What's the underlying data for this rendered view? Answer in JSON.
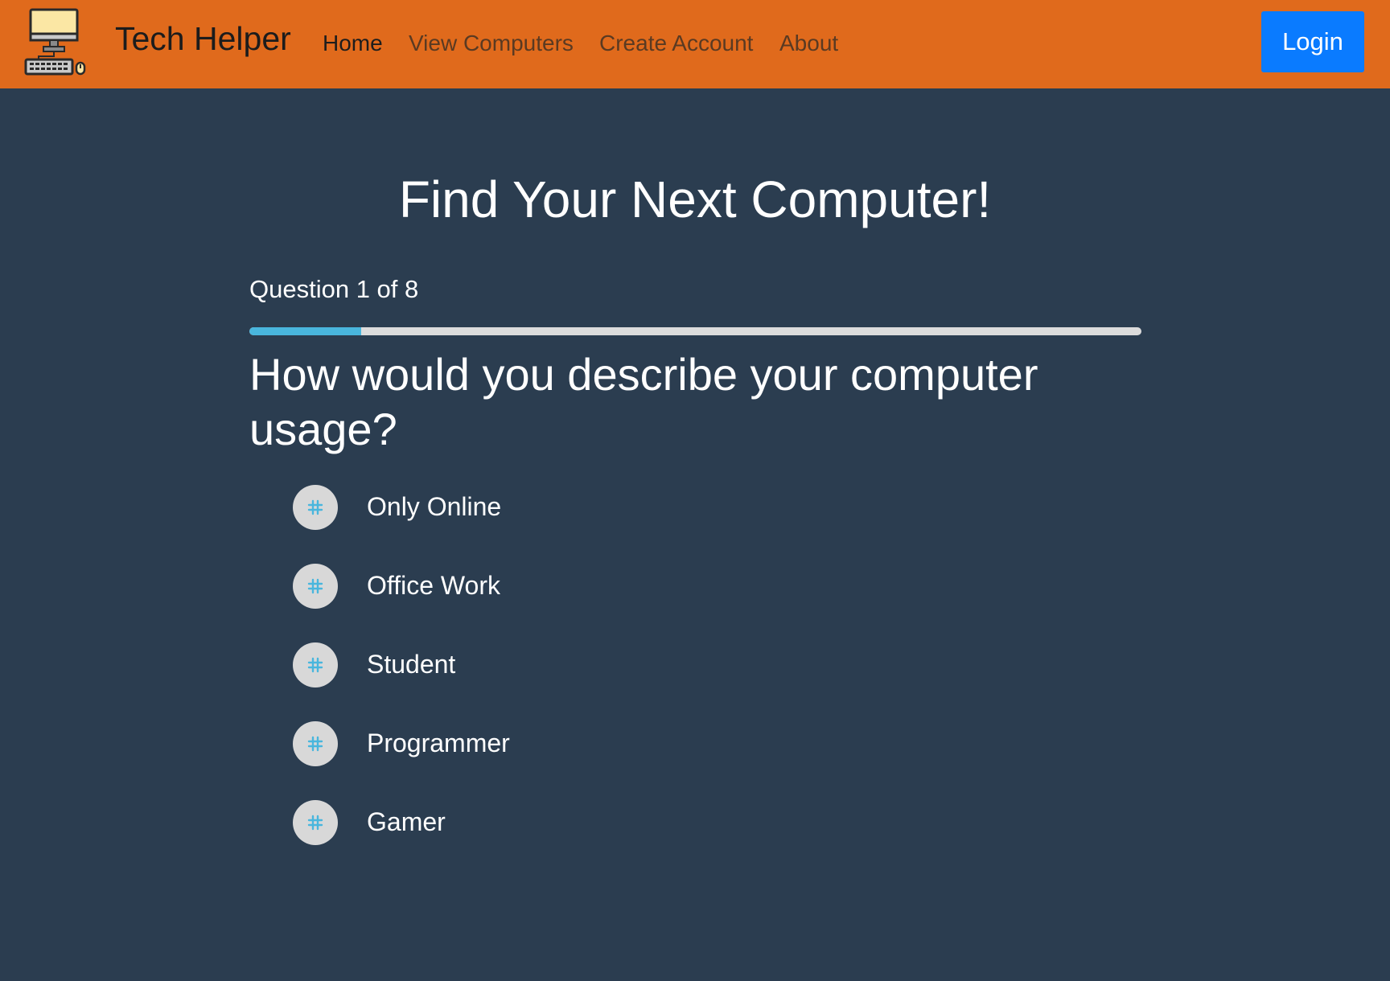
{
  "navbar": {
    "brand": "Tech Helper",
    "logo_icon": "computer-icon",
    "links": [
      "Home",
      "View Computers",
      "Create Account",
      "About"
    ],
    "login_label": "Login"
  },
  "colors": {
    "navbar": "#e06a1c",
    "background": "#2b3d50",
    "login_button": "#0a7bff",
    "progress_fill": "#49b6dd",
    "progress_track": "#dcdcdc"
  },
  "quiz": {
    "title": "Find Your Next Computer!",
    "counter": "Question 1 of 8",
    "progress_fraction": 0.125,
    "question": "How would you describe your computer usage?",
    "options": [
      "Only Online",
      "Office Work",
      "Student",
      "Programmer",
      "Gamer"
    ]
  }
}
